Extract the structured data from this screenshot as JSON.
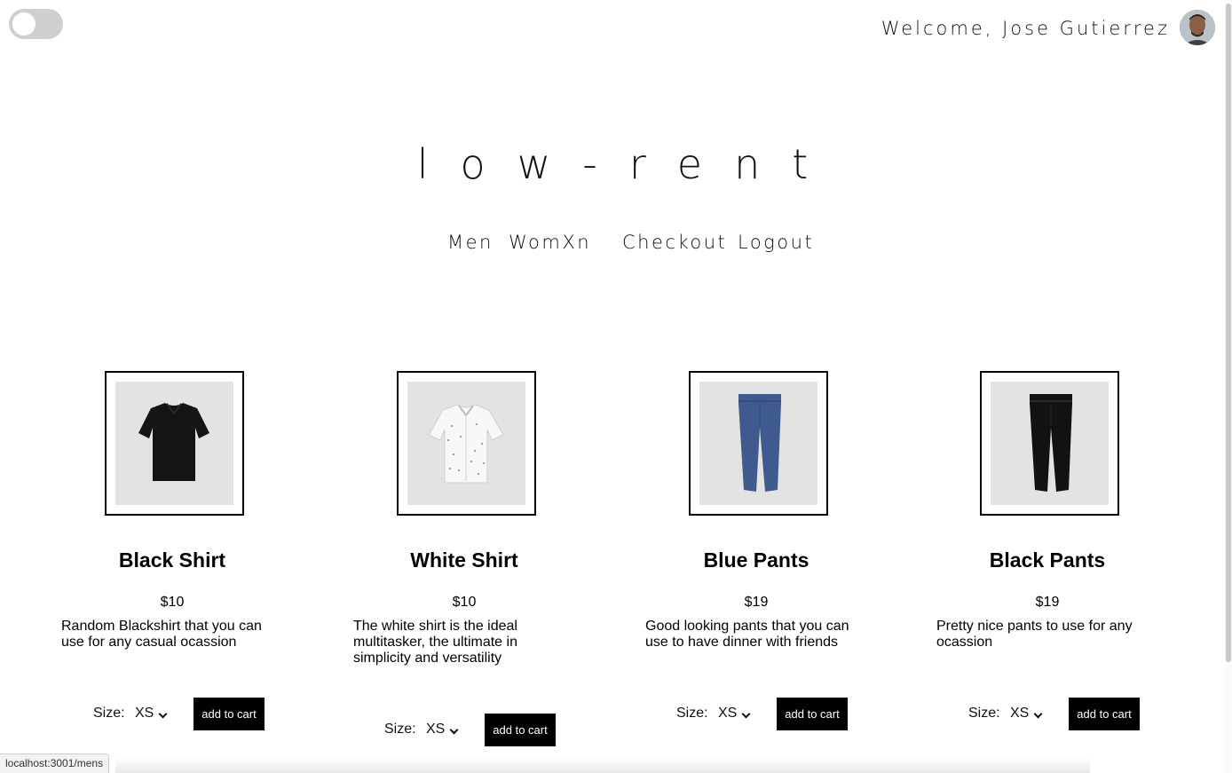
{
  "header": {
    "theme_toggle": "off",
    "welcome_text": "Welcome, Jose Gutierrez"
  },
  "brand": {
    "logo_text": "low-rent"
  },
  "nav": {
    "items": [
      {
        "label": "Men"
      },
      {
        "label": "WomXn"
      },
      {
        "label": "Checkout"
      },
      {
        "label": "Logout"
      }
    ]
  },
  "products": [
    {
      "name": "Black Shirt",
      "price": "$10",
      "description": "Random Blackshirt that you can use for any casual ocassion",
      "size_label": "Size:",
      "size_value": "XS",
      "button_label": "add to cart",
      "image": "black-shirt"
    },
    {
      "name": "White Shirt",
      "price": "$10",
      "description": "The white shirt is the ideal multitasker, the ultimate in simplicity and versatility",
      "size_label": "Size:",
      "size_value": "XS",
      "button_label": "add to cart",
      "image": "white-shirt"
    },
    {
      "name": "Blue Pants",
      "price": "$19",
      "description": "Good looking pants that you can use to have dinner with friends",
      "size_label": "Size:",
      "size_value": "XS",
      "button_label": "add to cart",
      "image": "blue-pants"
    },
    {
      "name": "Black Pants",
      "price": "$19",
      "description": "Pretty nice pants to use for any ocassion",
      "size_label": "Size:",
      "size_value": "XS",
      "button_label": "add to cart",
      "image": "black-pants"
    }
  ],
  "status_bar": {
    "url": "localhost:3001/mens"
  }
}
